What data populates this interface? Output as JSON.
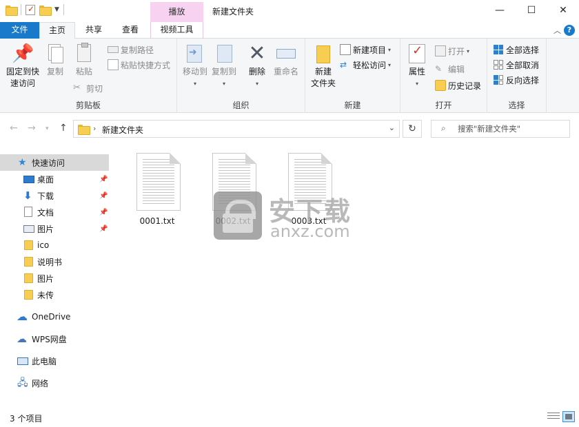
{
  "window": {
    "title": "新建文件夹",
    "context_tab_header": "播放",
    "controls": {
      "minimize": "—",
      "maximize": "☐",
      "close": "✕"
    }
  },
  "quick_access_toolbar": {
    "icons": [
      "folder-icon",
      "properties-icon",
      "new-folder-icon",
      "customize-dropdown-icon"
    ]
  },
  "ribbon_tabs": [
    {
      "label": "文件",
      "active": false
    },
    {
      "label": "主页",
      "active": true
    },
    {
      "label": "共享",
      "active": false
    },
    {
      "label": "查看",
      "active": false
    },
    {
      "label": "视频工具",
      "active": false
    }
  ],
  "ribbon": {
    "clipboard": {
      "label": "剪贴板",
      "pin_quick_access_line1": "固定到快",
      "pin_quick_access_line2": "速访问",
      "copy": "复制",
      "paste": "粘贴",
      "copy_path": "复制路径",
      "paste_shortcut": "粘贴快捷方式",
      "cut": "剪切"
    },
    "organize": {
      "label": "组织",
      "move_to": "移动到",
      "copy_to": "复制到",
      "delete": "删除",
      "rename": "重命名"
    },
    "new": {
      "label": "新建",
      "new_folder_line1": "新建",
      "new_folder_line2": "文件夹",
      "new_item": "新建项目",
      "easy_access": "轻松访问"
    },
    "open": {
      "label": "打开",
      "properties": "属性",
      "open": "打开",
      "edit": "编辑",
      "history": "历史记录"
    },
    "select": {
      "label": "选择",
      "select_all": "全部选择",
      "select_none": "全部取消",
      "invert_selection": "反向选择"
    }
  },
  "address_bar": {
    "path": "新建文件夹",
    "search_placeholder": "搜索\"新建文件夹\""
  },
  "nav_pane": {
    "quick_access": "快速访问",
    "pinned": [
      {
        "label": "桌面",
        "icon": "desktop-icon"
      },
      {
        "label": "下载",
        "icon": "download-icon"
      },
      {
        "label": "文档",
        "icon": "documents-icon"
      },
      {
        "label": "图片",
        "icon": "pictures-icon"
      }
    ],
    "recent_folders": [
      "ico",
      "说明书",
      "图片",
      "未传"
    ],
    "onedrive": "OneDrive",
    "wps_cloud": "WPS网盘",
    "this_pc": "此电脑",
    "network": "网络"
  },
  "files": [
    {
      "name": "0001.txt"
    },
    {
      "name": "0002.txt"
    },
    {
      "name": "0003.txt"
    }
  ],
  "watermark": {
    "title": "安下载",
    "subtitle": "anxz.com"
  },
  "status_bar": {
    "item_count": "3 个项目"
  },
  "colors": {
    "file_tab": "#1979ca",
    "context_tab": "#f7d3f1",
    "ribbon_bg": "#f5f6f7",
    "selection": "#cce8ff"
  }
}
